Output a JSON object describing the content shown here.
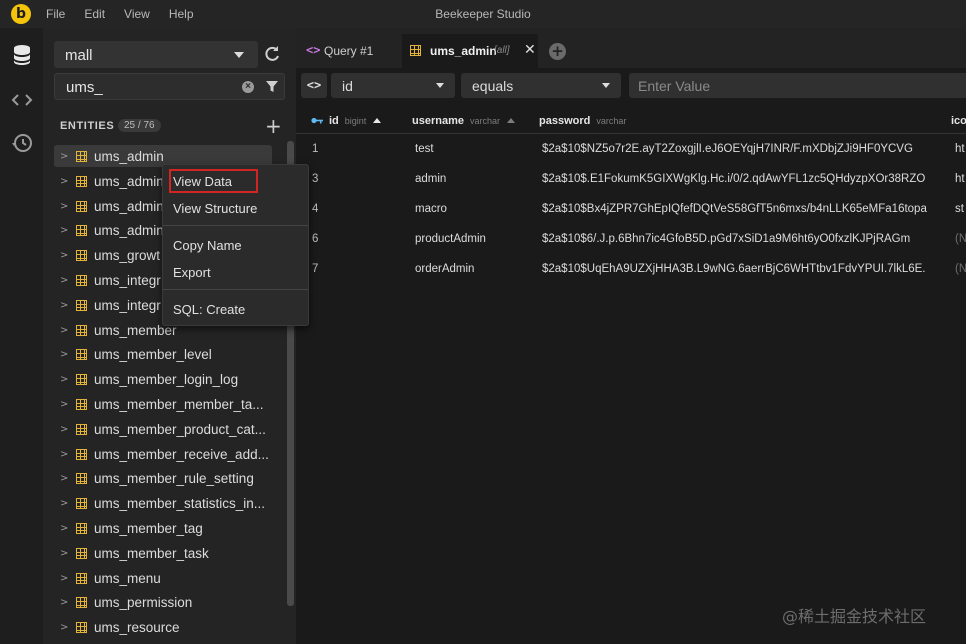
{
  "app": {
    "title": "Beekeeper Studio",
    "menu": [
      "File",
      "Edit",
      "View",
      "Help"
    ]
  },
  "sidebar": {
    "connection": "mall",
    "filter_value": "ums_",
    "entities_label": "ENTITIES",
    "entities_count": "25 / 76",
    "tables": [
      "ums_admin",
      "ums_admin",
      "ums_admin",
      "ums_admin",
      "ums_growt",
      "ums_integr",
      "ums_integr",
      "ums_member",
      "ums_member_level",
      "ums_member_login_log",
      "ums_member_member_ta...",
      "ums_member_product_cat...",
      "ums_member_receive_add...",
      "ums_member_rule_setting",
      "ums_member_statistics_in...",
      "ums_member_tag",
      "ums_member_task",
      "ums_menu",
      "ums_permission",
      "ums_resource"
    ]
  },
  "context_menu": {
    "view_data": "View Data",
    "view_structure": "View Structure",
    "copy_name": "Copy Name",
    "export": "Export",
    "sql_create": "SQL: Create",
    "highlight_color": "#d32424"
  },
  "tabs": {
    "query": {
      "icon": "<>",
      "label": "Query #1"
    },
    "table": {
      "label": "ums_admin",
      "sub": "[all]"
    }
  },
  "filter": {
    "column": "id",
    "operator": "equals",
    "value_placeholder": "Enter Value"
  },
  "grid": {
    "columns": [
      {
        "name": "id",
        "type": "bigint"
      },
      {
        "name": "username",
        "type": "varchar"
      },
      {
        "name": "password",
        "type": "varchar"
      },
      {
        "name": "ico",
        "type": ""
      }
    ],
    "rows": [
      {
        "id": "1",
        "username": "test",
        "password": "$2a$10$NZ5o7r2E.ayT2ZoxgjlI.eJ6OEYqjH7INR/F.mXDbjZJi9HF0YCVG",
        "icon": "ht"
      },
      {
        "id": "3",
        "username": "admin",
        "password": "$2a$10$.E1FokumK5GIXWgKlg.Hc.i/0/2.qdAwYFL1zc5QHdyzpXOr38RZO",
        "icon": "ht"
      },
      {
        "id": "4",
        "username": "macro",
        "password": "$2a$10$Bx4jZPR7GhEpIQfefDQtVeS58GfT5n6mxs/b4nLLK65eMFa16topa",
        "icon": "st"
      },
      {
        "id": "6",
        "username": "productAdmin",
        "password": "$2a$10$6/.J.p.6Bhn7ic4GfoB5D.pGd7xSiD1a9M6ht6yO0fxzlKJPjRAGm",
        "icon": "(N"
      },
      {
        "id": "7",
        "username": "orderAdmin",
        "password": "$2a$10$UqEhA9UZXjHHA3B.L9wNG.6aerrBjC6WHTtbv1FdvYPUI.7lkL6E.",
        "icon": "(N"
      }
    ]
  },
  "watermark": "@稀土掘金技术社区",
  "colors": {
    "logo": "#f4c40a",
    "table_icon": "#e3b33a",
    "key_icon": "#5fb8f2",
    "query_icon": "#c678dd"
  }
}
